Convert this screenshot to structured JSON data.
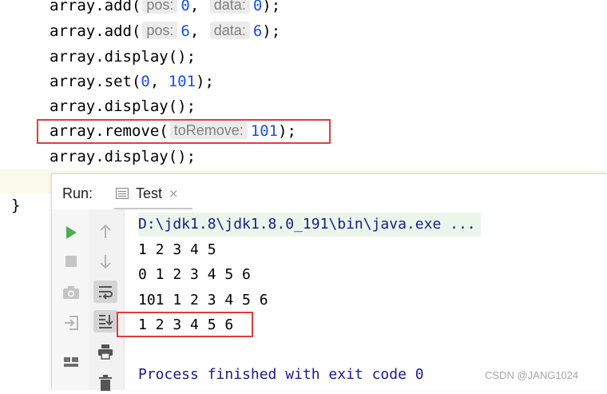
{
  "editor": {
    "lines": [
      {
        "prefix": "array.add(",
        "hint1": "pos:",
        "arg1": "0",
        "sep": ",",
        "hint2": "data:",
        "arg2": "0",
        "suffix": ");"
      },
      {
        "prefix": "array.add(",
        "hint1": "pos:",
        "arg1": "6",
        "sep": ",",
        "hint2": "data:",
        "arg2": "6",
        "suffix": ");"
      },
      {
        "text": "array.display();"
      },
      {
        "prefix": "array.set(",
        "arg1": "0",
        "sep": ", ",
        "arg2": "101",
        "suffix": ");"
      },
      {
        "text": "array.display();"
      },
      {
        "prefix": "array.remove(",
        "hint1": "toRemove:",
        "arg1": "101",
        "suffix": ");"
      },
      {
        "text": "array.display();"
      }
    ],
    "closing_brace": "}"
  },
  "run_panel": {
    "label": "Run:",
    "tab_label": "Test",
    "tab_close": "×",
    "output": [
      "D:\\jdk1.8\\jdk1.8.0_191\\bin\\java.exe ...",
      "1 2 3 4 5",
      "0 1 2 3 4 5 6",
      "101 1 2 3 4 5 6",
      "1 2 3 4 5 6",
      "Process finished with exit code 0"
    ]
  },
  "icons": {
    "run": "play-icon",
    "stop": "stop-icon",
    "camera": "camera-icon",
    "login": "login-icon",
    "layout": "layout-icon",
    "up": "arrow-up-icon",
    "down": "arrow-down-icon",
    "wrap": "soft-wrap-icon",
    "scroll": "scroll-to-end-icon",
    "print": "print-icon",
    "trash": "trash-icon"
  },
  "colors": {
    "number": "#1750eb",
    "highlight": "#e03c3c",
    "run_green": "#4caf50",
    "console_blue": "#1a1a8c"
  },
  "watermark": "CSDN @JANG1024"
}
